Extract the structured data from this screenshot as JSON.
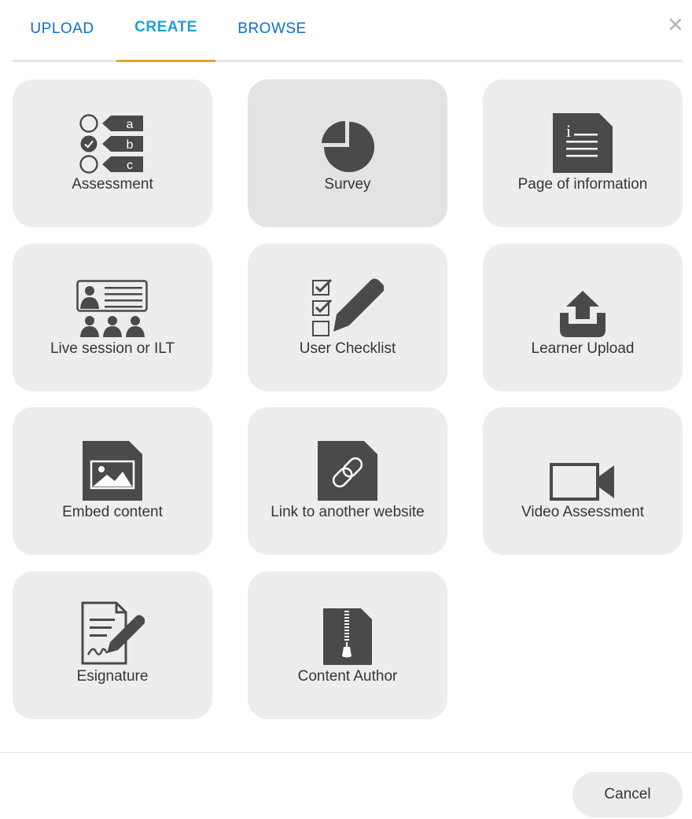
{
  "tabs": [
    {
      "label": "UPLOAD",
      "active": false
    },
    {
      "label": "CREATE",
      "active": true
    },
    {
      "label": "BROWSE",
      "active": false
    }
  ],
  "close": {
    "icon": "close-icon",
    "glyph": "×"
  },
  "tiles": [
    {
      "label": "Assessment",
      "icon": "assessment-icon",
      "icon_letters": [
        "a",
        "b",
        "c"
      ]
    },
    {
      "label": "Survey",
      "icon": "pie-chart-icon"
    },
    {
      "label": "Page of information",
      "icon": "information-document-icon",
      "icon_letter": "i"
    },
    {
      "label": "Live session or ILT",
      "icon": "live-session-icon"
    },
    {
      "label": "User Checklist",
      "icon": "checklist-icon"
    },
    {
      "label": "Learner Upload",
      "icon": "upload-icon"
    },
    {
      "label": "Embed content",
      "icon": "image-document-icon"
    },
    {
      "label": "Link to another website",
      "icon": "link-document-icon"
    },
    {
      "label": "Video Assessment",
      "icon": "video-camera-icon"
    },
    {
      "label": "Esignature",
      "icon": "esignature-icon"
    },
    {
      "label": "Content Author",
      "icon": "zip-file-icon"
    }
  ],
  "footer": {
    "cancel_label": "Cancel"
  },
  "colors": {
    "accent": "#1ea0d8",
    "tab_text": "#0a6ed1",
    "tab_indicator": "#e7a32c",
    "tile_bg": "#ededed",
    "icon": "#4a4a4a"
  }
}
